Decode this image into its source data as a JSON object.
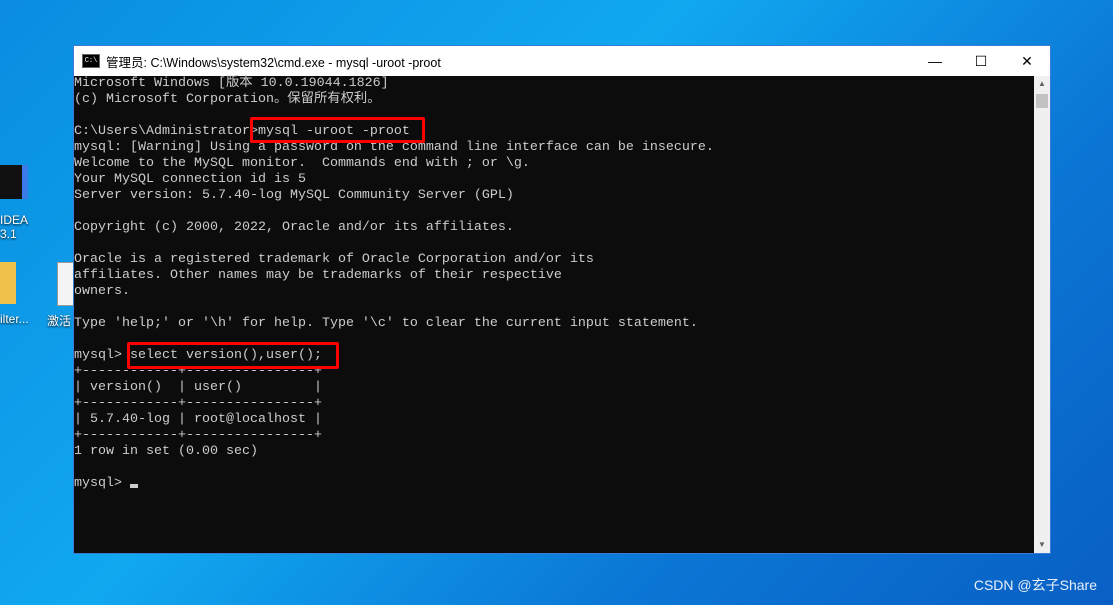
{
  "desktop": {
    "icons": [
      {
        "label": "IDEA",
        "sub": "3.1"
      },
      {
        "label": "ilter..."
      },
      {
        "label": "激活"
      }
    ]
  },
  "window": {
    "title": "管理员: C:\\Windows\\system32\\cmd.exe - mysql  -uroot -proot",
    "icon": "cmd-icon",
    "controls": {
      "minimize": "—",
      "maximize": "☐",
      "close": "✕"
    }
  },
  "console": {
    "lines": [
      "Microsoft Windows [版本 10.0.19044.1826]",
      "(c) Microsoft Corporation。保留所有权利。",
      "",
      "C:\\Users\\Administrator>mysql -uroot -proot",
      "mysql: [Warning] Using a password on the command line interface can be insecure.",
      "Welcome to the MySQL monitor.  Commands end with ; or \\g.",
      "Your MySQL connection id is 5",
      "Server version: 5.7.40-log MySQL Community Server (GPL)",
      "",
      "Copyright (c) 2000, 2022, Oracle and/or its affiliates.",
      "",
      "Oracle is a registered trademark of Oracle Corporation and/or its",
      "affiliates. Other names may be trademarks of their respective",
      "owners.",
      "",
      "Type 'help;' or '\\h' for help. Type '\\c' to clear the current input statement.",
      "",
      "mysql> select version(),user();",
      "+------------+----------------+",
      "| version()  | user()         |",
      "+------------+----------------+",
      "| 5.7.40-log | root@localhost |",
      "+------------+----------------+",
      "1 row in set (0.00 sec)",
      ""
    ],
    "prompt": "mysql> "
  },
  "highlight_color": "#ff0000",
  "watermark": "CSDN @玄子Share"
}
